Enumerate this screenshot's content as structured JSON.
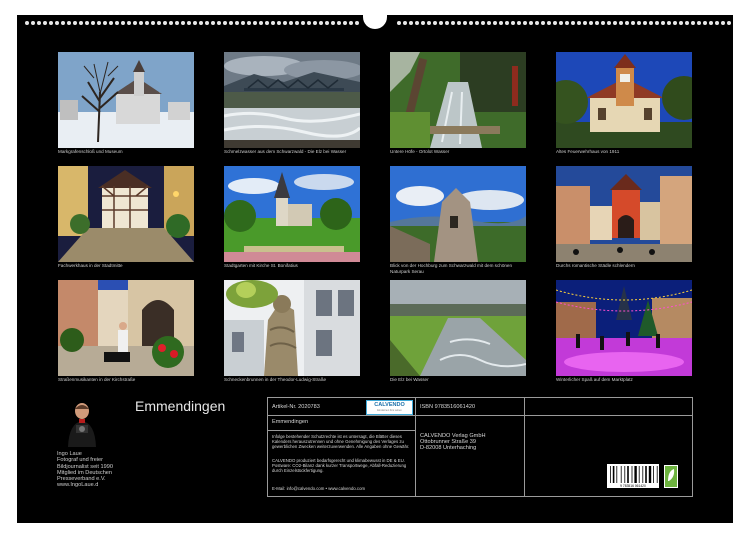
{
  "calendar": {
    "title": "Emmendingen",
    "author": {
      "name": "Ingo Laue",
      "bio_lines": [
        "Fotograf und freier",
        "Bildjournalist seit 1990",
        "Mitglied im Deutschen",
        "Presseverband e.V.",
        "www.IngoLaue.d"
      ]
    }
  },
  "photos": [
    {
      "caption": "Markgrafenschloß und Museum",
      "icon": "photo-castle-winter"
    },
    {
      "caption": "Schmelzwasser aus dem Schwarzwald - Die Elz bei Wasser",
      "icon": "photo-river-bridge"
    },
    {
      "caption": "Untere Höfe - Ortolot Wasser",
      "icon": "photo-stream-path"
    },
    {
      "caption": "Altes Feuerwehrhaus von 1911",
      "icon": "photo-fire-station"
    },
    {
      "caption": "Fachwerkhaus in der Stadtmitte",
      "icon": "photo-timber-house"
    },
    {
      "caption": "Stadtgarten mit Kirche St. Bonifatius",
      "icon": "photo-church-park"
    },
    {
      "caption": "Blick von der Hochburg zum Schwarzwald mit dem schönen Naturpark Serau",
      "icon": "photo-ruin-view"
    },
    {
      "caption": "Durchs romantische Städle schlendern",
      "icon": "photo-old-town-gate"
    },
    {
      "caption": "Straßenmusikanten in der Kirchstraße",
      "icon": "photo-street-musician"
    },
    {
      "caption": "Schneckenbrunnen in der Theodor-Ludwig-Straße",
      "icon": "photo-fountain-statue"
    },
    {
      "caption": "Die Elz bei Wasser",
      "icon": "photo-river-meadow"
    },
    {
      "caption": "Winterlicher Spaß auf dem Marktplatz",
      "icon": "photo-ice-rink"
    }
  ],
  "info": {
    "article": "Artikel-Nr. 2020783",
    "isbn": "ISBN 9783516061420",
    "name": "Emmendingen",
    "logo": "CALVENDO",
    "logo_sub": "Emotionen fürs Leben",
    "publisher": [
      "CALVENDO Verlag GmbH",
      "Ottobrunner Straße 39",
      "D-82008 Unterhaching"
    ],
    "legal1": "Infolge bestehender Schutzrechte ist es untersagt, die Blätter dieses Kalenders herauszutrennen und ohne Genehmigung des Verlages zu gewerblichen Zwecken weiterzuverwenden. Alle Angaben ohne Gewähr.",
    "legal2": "CALVENDO produziert bedarfsgerecht und klimabewusst in DE & EU. Postware: CO2-Bilanz dank kurzer Transportwege, Abfall-Reduzierung durch Einzelstückfertigung.",
    "email": "E-Mail: info@calvendo.com • www.calvendo.com",
    "barcode": "9 783516 061420"
  },
  "colors": {
    "background": "#000000",
    "text": "#cfcfcf",
    "frame": "#9a9a9a"
  }
}
